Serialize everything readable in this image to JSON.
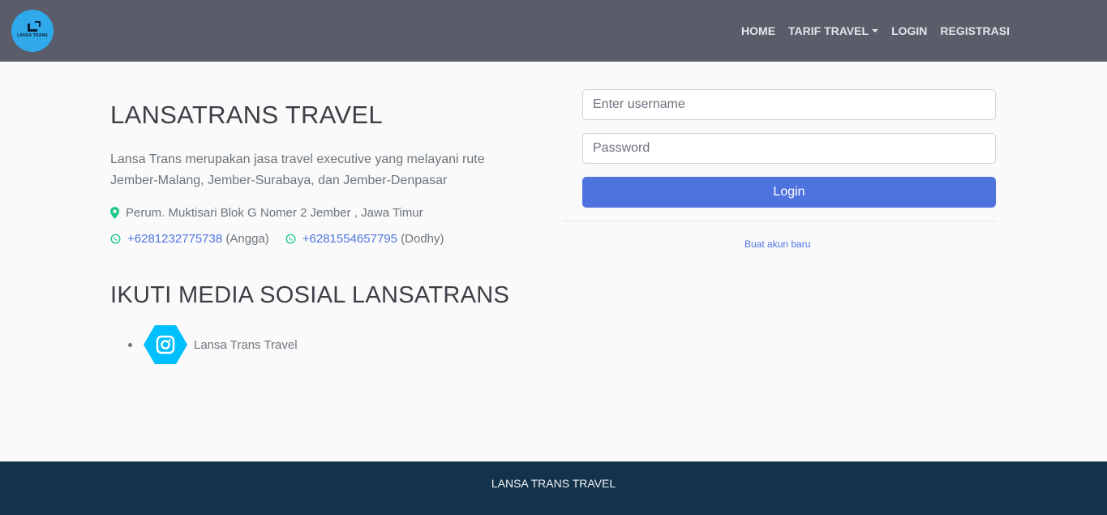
{
  "navbar": {
    "logo_text": "LANSA TRANS",
    "items": [
      {
        "label": "HOME"
      },
      {
        "label": "TARIF TRAVEL"
      },
      {
        "label": "LOGIN"
      },
      {
        "label": "REGISTRASI"
      }
    ]
  },
  "info": {
    "title": "LANSATRANS TRAVEL",
    "description": "Lansa Trans merupakan jasa travel executive yang melayani rute Jember-Malang, Jember-Surabaya, dan Jember-Denpasar",
    "address": "Perum. Muktisari Blok G Nomer 2 Jember , Jawa Timur",
    "contacts": [
      {
        "phone": "+6281232775738",
        "name": "(Angga)"
      },
      {
        "phone": "+6281554657795",
        "name": "(Dodhy)"
      }
    ]
  },
  "social": {
    "title": "IKUTI MEDIA SOSIAL LANSATRANS",
    "items": [
      {
        "icon": "instagram-icon",
        "label": "Lansa Trans Travel"
      }
    ]
  },
  "login_form": {
    "username_placeholder": "Enter username",
    "username_value": "",
    "password_placeholder": "Password",
    "password_value": "",
    "submit_label": "Login",
    "new_account_link": "Buat akun baru"
  },
  "footer": {
    "text": "LANSA TRANS TRAVEL"
  },
  "colors": {
    "navbar": "#5a5c69",
    "primary": "#4e73df",
    "footer": "#123349",
    "logo_bg": "#2fa9e9",
    "instagram_badge": "#00bfff",
    "accent_icons": "#1cc88a"
  }
}
